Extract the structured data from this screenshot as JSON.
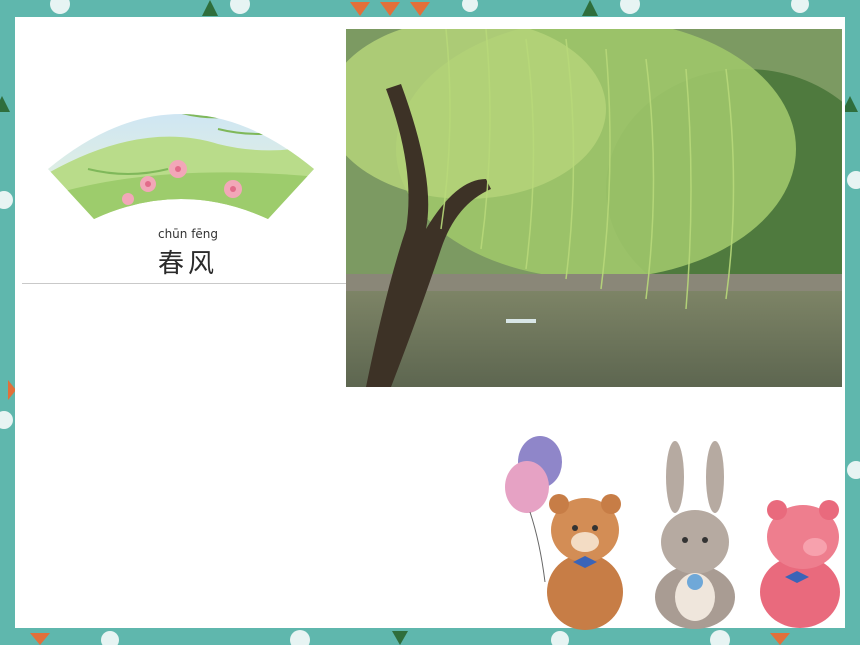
{
  "fan_card": {
    "pinyin": "chūn fēng",
    "title": "春风"
  },
  "photo": {
    "subject-icon": "willow-tree-by-lake"
  },
  "illustration": {
    "characters": [
      "bear-with-balloons",
      "rabbit-with-flower",
      "pig"
    ]
  },
  "colors": {
    "border_teal": "#5fb7ad",
    "slide_bg": "#ffffff",
    "willow_green": "#a8cf6a",
    "water": "#6b7458"
  }
}
